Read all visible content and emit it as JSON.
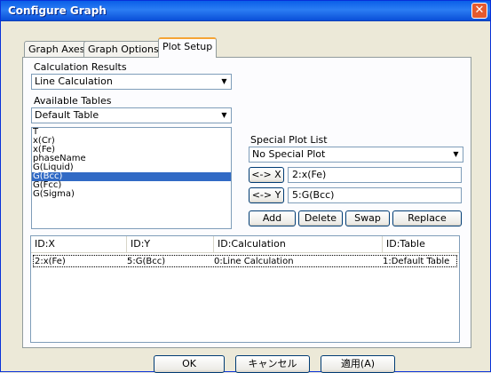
{
  "window": {
    "title": "Configure Graph",
    "close_glyph": "✕"
  },
  "tabs": [
    {
      "label": "Graph Axes",
      "active": false
    },
    {
      "label": "Graph Options",
      "active": false
    },
    {
      "label": "Plot Setup",
      "active": true
    }
  ],
  "calculation_results": {
    "label": "Calculation Results",
    "value": "Line Calculation"
  },
  "available_tables": {
    "label": "Available Tables",
    "value": "Default Table"
  },
  "columns_list": {
    "items": [
      "T",
      "x(Cr)",
      "x(Fe)",
      "phaseName",
      "G(Liquid)",
      "G(Bcc)",
      "G(Fcc)",
      "G(Sigma)"
    ],
    "selected": "G(Bcc)"
  },
  "special_plot": {
    "label": "Special Plot List",
    "value": "No Special Plot"
  },
  "x_assign": {
    "button": "<-> X",
    "value": "2:x(Fe)"
  },
  "y_assign": {
    "button": "<-> Y",
    "value": "5:G(Bcc)"
  },
  "actions": {
    "add": "Add",
    "delete": "Delete",
    "swap": "Swap",
    "replace": "Replace"
  },
  "plot_table": {
    "headers": [
      "ID:X",
      "ID:Y",
      "ID:Calculation",
      "ID:Table"
    ],
    "rows": [
      [
        "2:x(Fe)",
        "5:G(Bcc)",
        "0:Line Calculation",
        "1:Default Table"
      ]
    ]
  },
  "footer": {
    "ok": "OK",
    "cancel": "キャンセル",
    "apply": "適用(A)"
  },
  "icons": {
    "dropdown": "chevron-down-icon",
    "close": "close-icon"
  },
  "colors": {
    "titlebar": "#0a5fe8",
    "close": "#e45a2e",
    "selection": "#316ac5",
    "active_tab_accent": "#f5a434"
  }
}
